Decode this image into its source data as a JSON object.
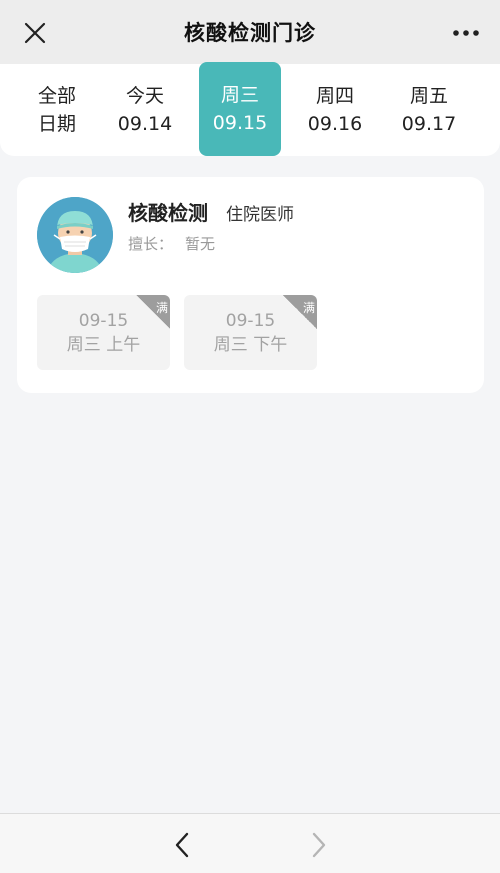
{
  "header": {
    "title": "核酸检测门诊",
    "close_icon": "close-icon",
    "more_icon": "more-dots-icon"
  },
  "dates": [
    {
      "line1": "全部",
      "line2": "日期",
      "active": false
    },
    {
      "line1": "今天",
      "line2": "09.14",
      "active": false
    },
    {
      "line1": "周三",
      "line2": "09.15",
      "active": true
    },
    {
      "line1": "周四",
      "line2": "09.16",
      "active": false
    },
    {
      "line1": "周五",
      "line2": "09.17",
      "active": false
    }
  ],
  "doctor": {
    "name": "核酸检测",
    "title": "住院医师",
    "specialty_label": "擅长：",
    "specialty_value": "暂无",
    "avatar_icon": "doctor-avatar-icon"
  },
  "slots": [
    {
      "date": "09-15",
      "period": "周三 上午",
      "status": "满"
    },
    {
      "date": "09-15",
      "period": "周三 下午",
      "status": "满"
    }
  ],
  "colors": {
    "accent": "#49b8b8",
    "full_badge": "#9d9d9d",
    "background": "#f4f5f7"
  },
  "bottom_nav": {
    "back_icon": "chevron-left-icon",
    "forward_icon": "chevron-right-icon"
  }
}
